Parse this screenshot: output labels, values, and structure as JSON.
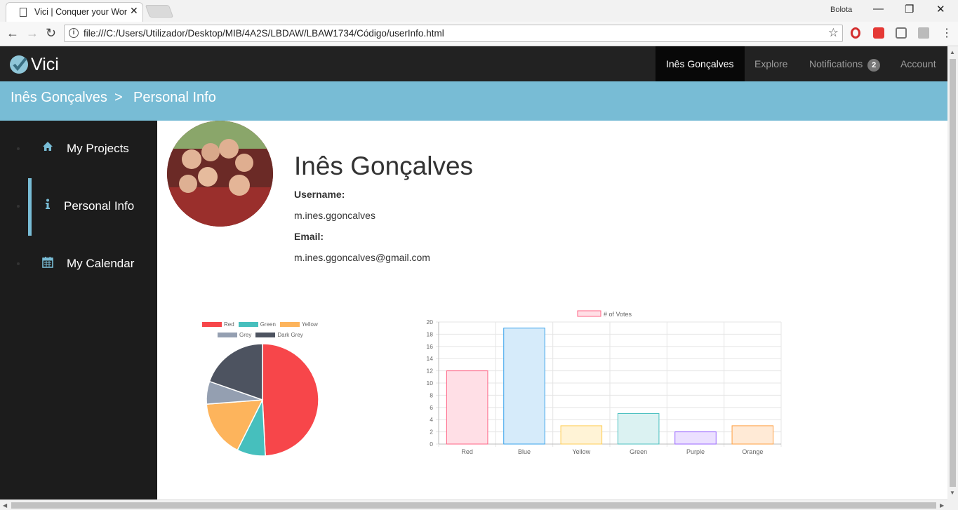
{
  "browser": {
    "tab_title": "Vici | Conquer your World",
    "tab_close": "✕",
    "user": "Bolota",
    "url": "file:///C:/Users/Utilizador/Desktop/MIB/4A2S/LBDAW/LBAW1734/Código/userInfo.html"
  },
  "navbar": {
    "brand": "Vici",
    "items": [
      {
        "label": "Inês Gonçalves",
        "active": true
      },
      {
        "label": "Explore"
      },
      {
        "label": "Notifications",
        "badge": "2"
      },
      {
        "label": "Account"
      }
    ]
  },
  "breadcrumb": {
    "user": "Inês Gonçalves",
    "separator": ">",
    "page": "Personal Info"
  },
  "sidebar": {
    "items": [
      {
        "label": "My Projects",
        "icon": "home-icon"
      },
      {
        "label": "Personal Info",
        "icon": "info-icon",
        "active": true
      },
      {
        "label": "My Calendar",
        "icon": "calendar-icon"
      }
    ]
  },
  "profile": {
    "name": "Inês Gonçalves",
    "username_label": "Username:",
    "username": "m.ines.ggoncalves",
    "email_label": "Email:",
    "email": "m.ines.ggoncalves@gmail.com"
  },
  "colors": {
    "accent": "#78bcd5",
    "navbar": "#222222",
    "sidebar": "#1c1c1c"
  },
  "chart_data": [
    {
      "type": "pie",
      "categories": [
        "Red",
        "Green",
        "Yellow",
        "Grey",
        "Dark Grey"
      ],
      "values": [
        300,
        50,
        100,
        40,
        120
      ],
      "colors": [
        "#f7464a",
        "#46bfbd",
        "#fdb45c",
        "#949fb1",
        "#4d5360"
      ],
      "legend": "top"
    },
    {
      "type": "bar",
      "categories": [
        "Red",
        "Blue",
        "Yellow",
        "Green",
        "Purple",
        "Orange"
      ],
      "series": [
        {
          "name": "# of Votes",
          "values": [
            12,
            19,
            3,
            5,
            2,
            3
          ]
        }
      ],
      "ylim": [
        0,
        20
      ],
      "yticks": [
        "0",
        "2",
        "4",
        "6",
        "8",
        "10",
        "12",
        "14",
        "16",
        "18",
        "20"
      ],
      "grid": true,
      "legend": "top",
      "fills": [
        "#ffdfe6",
        "#d6ebfa",
        "#fff3d6",
        "#dbf2f2",
        "#ebe0ff",
        "#ffead6"
      ],
      "strokes": [
        "#ff6384",
        "#36a2eb",
        "#ffce56",
        "#4bc0c0",
        "#9966ff",
        "#ff9f40"
      ]
    }
  ]
}
